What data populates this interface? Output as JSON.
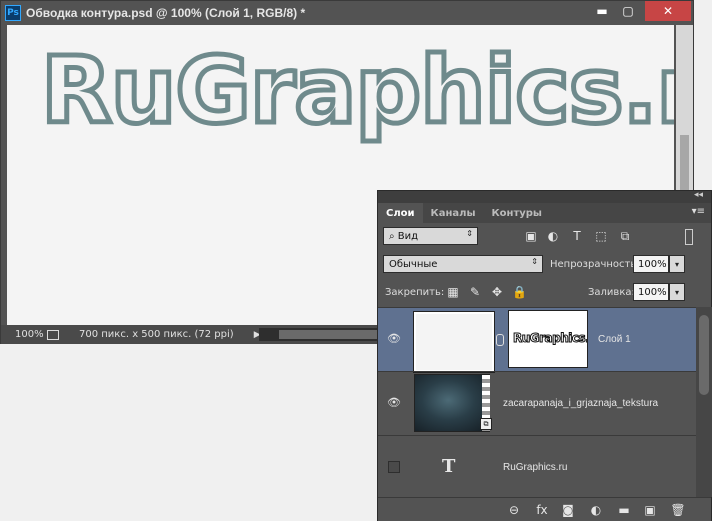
{
  "window": {
    "title": "Обводка контура.psd @ 100% (Слой 1, RGB/8) *",
    "app_icon": "Ps",
    "minimize_glyph": "▬",
    "maximize_glyph": "▢",
    "close_glyph": "✕"
  },
  "canvas": {
    "artwork_text": "RuGraphics.ru"
  },
  "statusbar": {
    "zoom": "100%",
    "doc_info": "700 пикс. x 500 пикс. (72 ppi)",
    "arrow": "▶"
  },
  "panel": {
    "collapse_glyph": "◂◂",
    "menu_glyph": "▾≡",
    "tabs": [
      {
        "label": "Слои",
        "active": true
      },
      {
        "label": "Каналы",
        "active": false
      },
      {
        "label": "Контуры",
        "active": false
      }
    ],
    "filter": {
      "label": "⌕ Вид",
      "arrow": "⇕",
      "icons": [
        "image-filter-icon",
        "adjustment-filter-icon",
        "type-filter-icon",
        "shape-filter-icon",
        "smartobject-filter-icon"
      ],
      "icon_glyphs": [
        "▣",
        "◐",
        "T",
        "⬚",
        "⧉"
      ]
    },
    "blend_mode": {
      "value": "Обычные",
      "arrow": "⇕"
    },
    "opacity": {
      "label": "Непрозрачность:",
      "value": "100%",
      "arrow": "▾"
    },
    "lock": {
      "label": "Закрепить:",
      "icons": [
        "lock-transparent-icon",
        "lock-image-icon",
        "lock-position-icon",
        "lock-all-icon"
      ],
      "icon_glyphs": [
        "▦",
        "✎",
        "✥",
        "🔒"
      ]
    },
    "fill": {
      "label": "Заливка:",
      "value": "100%",
      "arrow": "▾"
    },
    "layers": [
      {
        "name": "Слой 1",
        "selected": true,
        "visible": true,
        "mask_text": "RuGraphics.ru"
      },
      {
        "name": "zacarapanaja_i_grjaznaja_tekstura",
        "selected": false,
        "visible": true
      },
      {
        "name": "RuGraphics.ru",
        "selected": false,
        "visible": false,
        "type_glyph": "T"
      }
    ],
    "footer_icons": [
      "link-layers-icon",
      "fx-icon",
      "add-mask-icon",
      "adjustment-layer-icon",
      "new-group-icon",
      "new-layer-icon",
      "trash-icon"
    ],
    "footer_glyphs": [
      "⊖",
      "fx",
      "◙",
      "◐",
      "▬",
      "▣",
      "🗑"
    ]
  },
  "colors": {
    "panel_bg": "#535353",
    "selected_layer": "#5f7190",
    "canvas_bg": "#f4f4f4",
    "close_button": "#c74545",
    "outline_text": "#6f8a8c"
  }
}
